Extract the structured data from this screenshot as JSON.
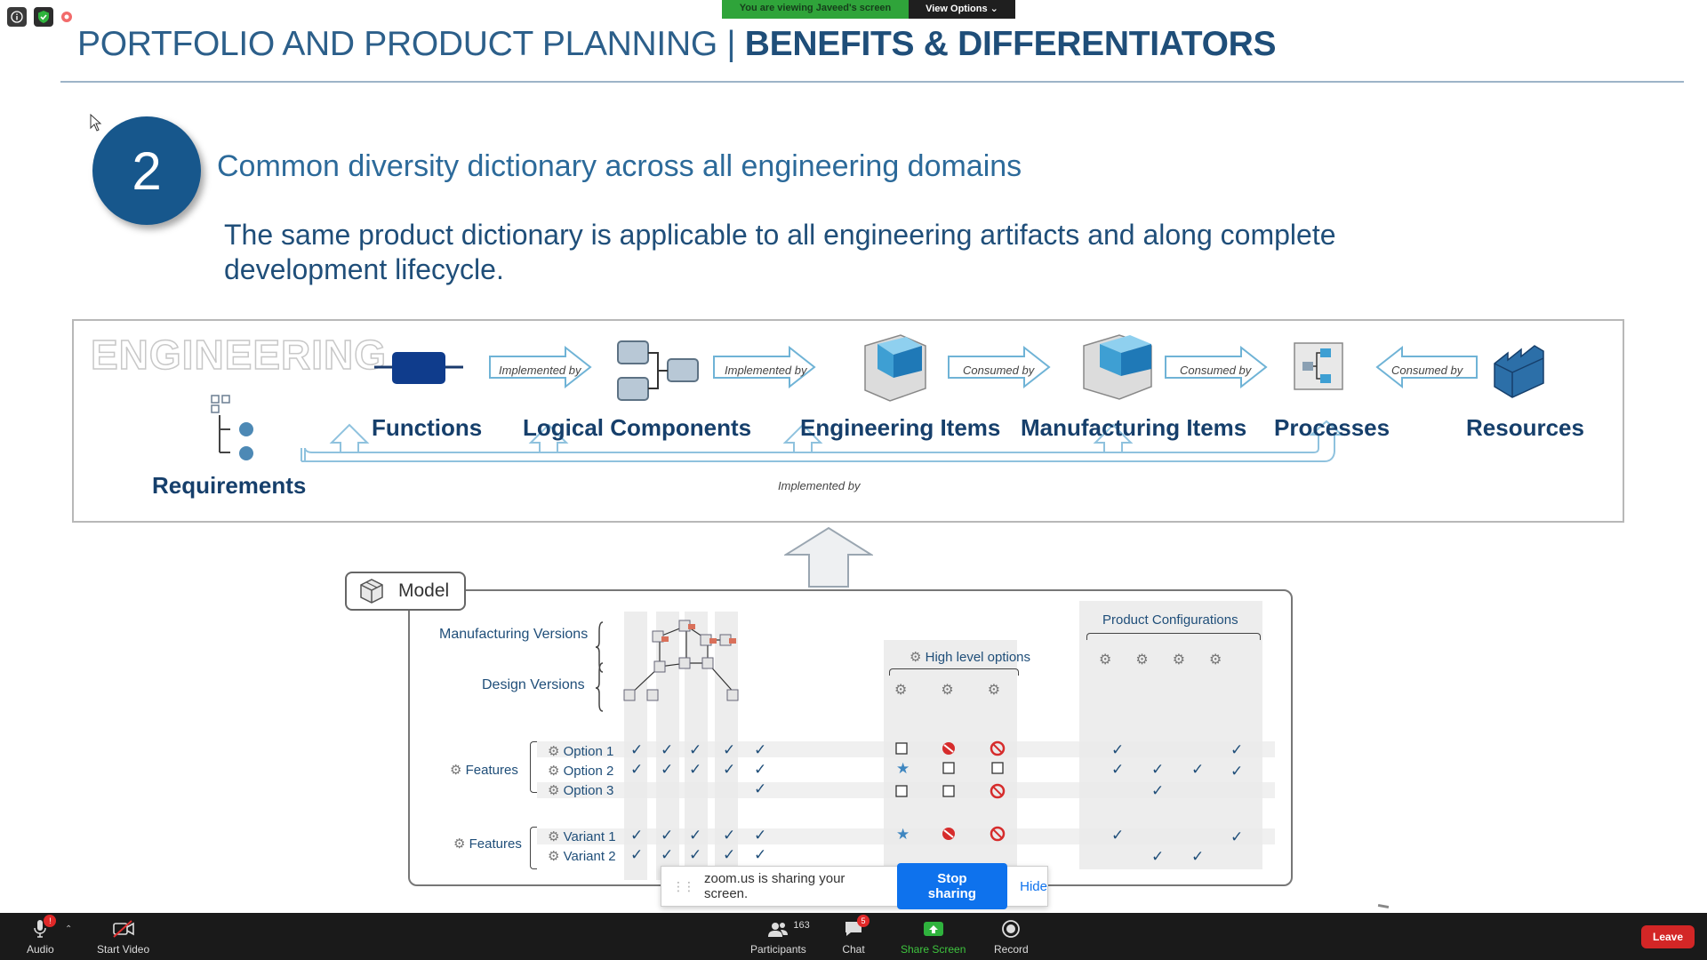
{
  "overlay": {
    "viewing_text": "You are viewing Javeed's screen",
    "view_options": "View Options"
  },
  "slide": {
    "title_part1": "PORTFOLIO AND PRODUCT PLANNING | ",
    "title_part2": "BENEFITS & DIFFERENTIATORS",
    "number": "2",
    "heading": "Common diversity dictionary across all engineering domains",
    "subtext": "The same product dictionary is applicable to all engineering artifacts and along complete development lifecycle.",
    "engineering": {
      "title": "ENGINEERING",
      "requirements": "Requirements",
      "functions": "Functions",
      "logical_components": "Logical Components",
      "engineering_items": "Engineering Items",
      "manufacturing_items": "Manufacturing Items",
      "processes": "Processes",
      "resources": "Resources",
      "implemented_by_1": "Implemented by",
      "implemented_by_2": "Implemented by",
      "consumed_by_1": "Consumed by",
      "consumed_by_2": "Consumed by",
      "consumed_by_3": "Consumed by",
      "implemented_by_bottom": "Implemented by"
    },
    "model": {
      "label": "Model",
      "manufacturing_versions": "Manufacturing  Versions",
      "design_versions": "Design  Versions",
      "high_level_options": "High level options",
      "product_configurations": "Product Configurations",
      "features_1": "Features",
      "features_2": "Features",
      "options": [
        "Option 1",
        "Option 2",
        "Option 3"
      ],
      "variants": [
        "Variant 1",
        "Variant 2"
      ]
    }
  },
  "share_popup": {
    "text": "zoom.us is sharing your screen.",
    "stop": "Stop sharing",
    "hide": "Hide"
  },
  "toolbar": {
    "audio": "Audio",
    "audio_badge": "!",
    "start_video": "Start Video",
    "participants": "Participants",
    "participants_count": "163",
    "chat": "Chat",
    "chat_badge": "5",
    "share_screen": "Share Screen",
    "record": "Record",
    "leave": "Leave"
  }
}
